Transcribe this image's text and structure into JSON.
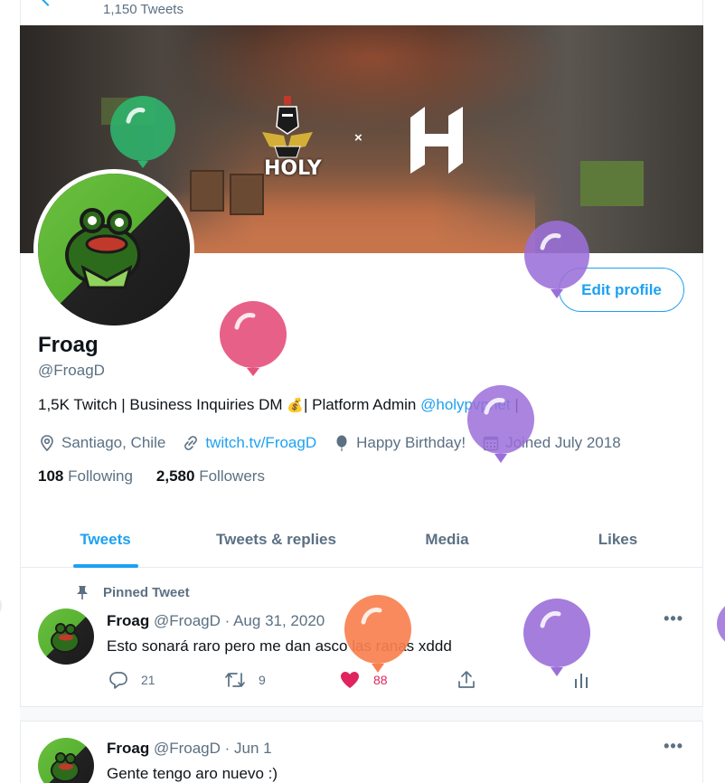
{
  "header": {
    "tweet_count": "1,150 Tweets"
  },
  "banner": {
    "left_logo_text": "HOLY",
    "separator": "×"
  },
  "profile": {
    "display_name": "Froag",
    "handle": "@FroagD",
    "edit_button": "Edit profile",
    "bio_prefix": "1,5K Twitch | Business Inquiries DM ",
    "bio_emoji": "💰",
    "bio_middle": "| Platform Admin ",
    "bio_mention": "@holypvpnet",
    "bio_suffix": " |",
    "location": "Santiago, Chile",
    "website": "twitch.tv/FroagD",
    "birthday": "Happy Birthday!",
    "joined": "Joined July 2018",
    "following_count": "108",
    "following_label": "Following",
    "followers_count": "2,580",
    "followers_label": "Followers"
  },
  "tabs": [
    {
      "label": "Tweets",
      "active": true
    },
    {
      "label": "Tweets & replies",
      "active": false
    },
    {
      "label": "Media",
      "active": false
    },
    {
      "label": "Likes",
      "active": false
    }
  ],
  "tweets": [
    {
      "pinned_label": "Pinned Tweet",
      "name": "Froag",
      "handle": "@FroagD",
      "date": "Aug 31, 2020",
      "text": "Esto sonará raro pero me dan asco las ranas xddd",
      "replies": "21",
      "retweets": "9",
      "likes": "88",
      "more": "•••"
    },
    {
      "name": "Froag",
      "handle": "@FroagD",
      "date": "Jun 1",
      "text": "Gente tengo aro nuevo :)",
      "more": "•••"
    }
  ],
  "colors": {
    "accent": "#1da1f2",
    "like": "#e0245e",
    "balloon_green": "#2fb36b",
    "balloon_pink": "#e5527e",
    "balloon_purple": "#9b6fd9",
    "balloon_orange": "#f8804f"
  },
  "icons": [
    "back-arrow-icon",
    "location-icon",
    "link-icon",
    "balloon-icon",
    "calendar-icon",
    "pin-icon",
    "reply-icon",
    "retweet-icon",
    "heart-icon",
    "share-icon",
    "analytics-icon",
    "more-icon"
  ]
}
